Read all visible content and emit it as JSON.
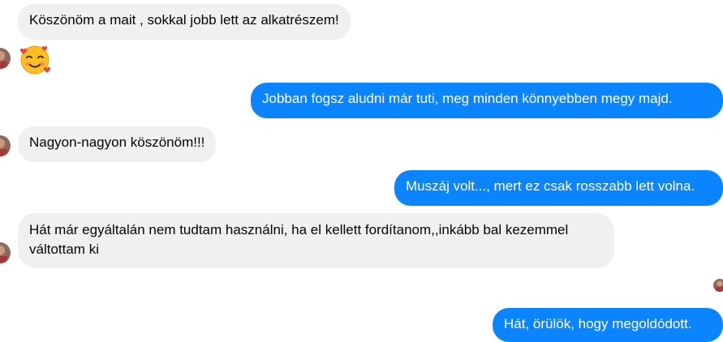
{
  "conversation": {
    "messages": [
      {
        "from": "them",
        "text": "Köszönöm a mait , sokkal jobb lett az alkatrészem!"
      },
      {
        "from": "them",
        "emoji": "smiling-face-with-hearts"
      },
      {
        "from": "me",
        "text": "Jobban fogsz aludni már tuti, meg minden könnyebben megy majd."
      },
      {
        "from": "them",
        "text": "Nagyon-nagyon köszönöm!!!"
      },
      {
        "from": "me",
        "text": "Muszáj volt..., mert ez csak rosszabb lett volna."
      },
      {
        "from": "them",
        "text": "Hát már egyáltalán nem tudtam használni, ha el kellett fordítanom,,inkább bal kezemmel váltottam ki"
      },
      {
        "from": "me",
        "text": "Hát, örülök, hogy megoldódott."
      }
    ]
  },
  "colors": {
    "incoming_bubble": "#f0f0f0",
    "outgoing_bubble": "#0a84ff",
    "outgoing_text": "#ffffff"
  }
}
